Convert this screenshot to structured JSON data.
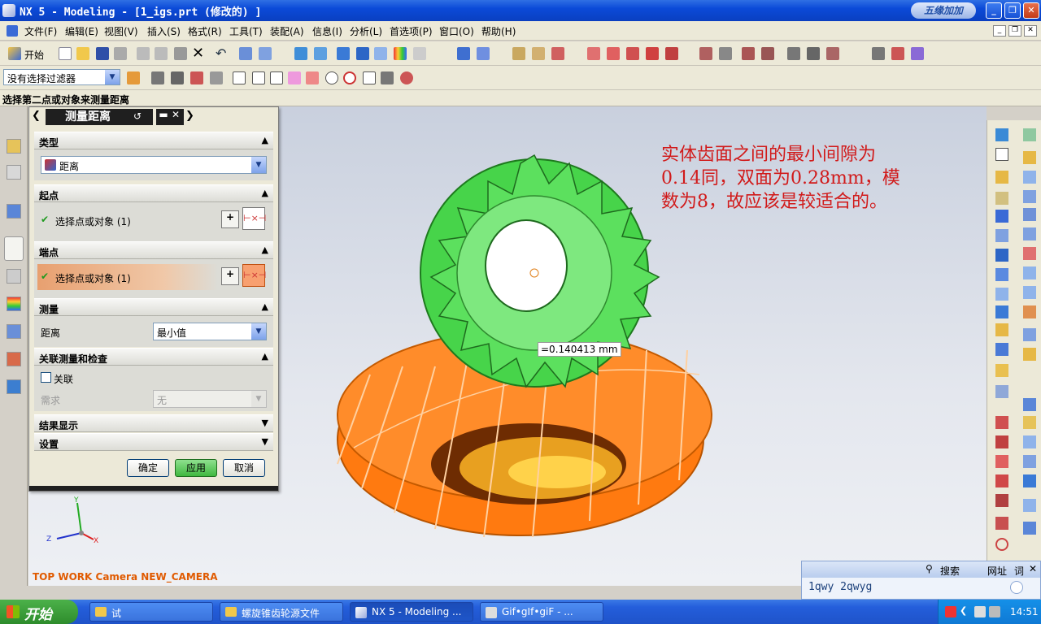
{
  "window": {
    "title": "NX 5 - Modeling - [1_igs.prt  (修改的) ]",
    "logo_text": "五缘加加"
  },
  "menu": [
    "文件(F)",
    "编辑(E)",
    "视图(V)",
    "插入(S)",
    "格式(R)",
    "工具(T)",
    "装配(A)",
    "信息(I)",
    "分析(L)",
    "首选项(P)",
    "窗口(O)",
    "帮助(H)"
  ],
  "toolbar": {
    "start_label": "开始",
    "filter_value": "没有选择过滤器"
  },
  "status_prompt": "选择第二点或对象来测量距离",
  "dialog": {
    "title": "测量距离",
    "type_section": "类型",
    "type_value": "距离",
    "start_section": "起点",
    "start_row": "选择点或对象 (1)",
    "end_section": "端点",
    "end_row": "选择点或对象 (1)",
    "measure_section": "测量",
    "distance_label": "距离",
    "distance_value": "最小值",
    "assoc_section": "关联测量和检查",
    "assoc_checkbox": "关联",
    "require_label": "需求",
    "require_value": "无",
    "result_section": "结果显示",
    "settings_section": "设置",
    "ok": "确定",
    "apply": "应用",
    "cancel": "取消"
  },
  "annotation": {
    "line1": "实体齿面之间的最小间隙为",
    "line2": "0.14同，双面为0.28mm，模",
    "line3": "数为8，故应该是较适合的。"
  },
  "measurement": "=0.140413 mm",
  "view_label": "TOP WORK Camera NEW_CAMERA",
  "axes": {
    "y": "Y",
    "z": "Z",
    "x": "X"
  },
  "chat": {
    "search": "搜索",
    "address": "网址",
    "word": "词",
    "text": "1qwy 2qwyg"
  },
  "taskbar": {
    "start": "开始",
    "tasks": [
      "试",
      "螺旋锥齿轮源文件",
      "NX 5 - Modeling ...",
      "Gif•gIf•giF - ..."
    ],
    "clock": "14:51"
  },
  "colors": {
    "accent": "#0a3fc0",
    "gear_green": "#47d44a",
    "gear_orange": "#ff7a10",
    "annotation": "#d11a1a"
  }
}
